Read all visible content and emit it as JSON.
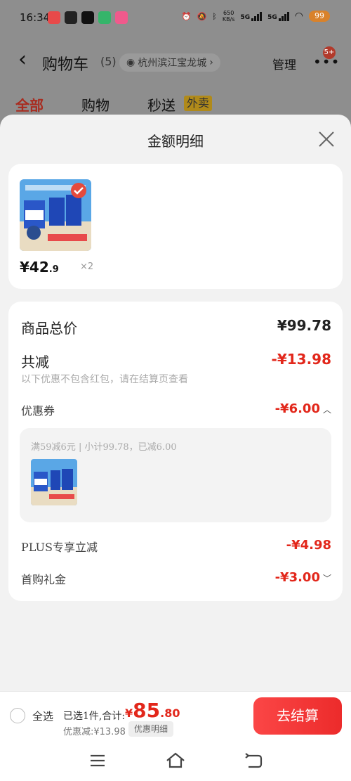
{
  "status_bar": {
    "time": "16:34",
    "net_speed_value": "650",
    "net_speed_unit": "KB/s",
    "net_type_1": "5G",
    "net_type_2": "5G",
    "battery": "99",
    "app_icon_colors": [
      "#e84a4a",
      "#222222",
      "#111111",
      "#35b56a",
      "#f05a8c"
    ]
  },
  "cart": {
    "back_icon": "chevron-left-icon",
    "title": "购物车",
    "count": "(5)",
    "location": "杭州滨江宝龙城",
    "manage": "管理",
    "more_badge": "5+",
    "tabs": [
      {
        "label": "全部",
        "active": true
      },
      {
        "label": "购物",
        "active": false
      },
      {
        "label": "秒送",
        "active": false
      }
    ],
    "waimai_tag": "外卖"
  },
  "sheet": {
    "title": "金额明细",
    "product": {
      "price_main": "¥42",
      "price_decimal": ".9",
      "quantity": "×2"
    },
    "detail": {
      "total_label": "商品总价",
      "total_value": "¥99.78",
      "reduce_label": "共减",
      "reduce_value": "-¥13.98",
      "reduce_note": "以下优惠不包含红包，请在结算页查看",
      "coupon_label": "优惠券",
      "coupon_value": "-¥6.00",
      "coupon_text": "满59减6元 | 小计99.78，已减6.00",
      "plus_label": "PLUS专享立减",
      "plus_value": "-¥4.98",
      "gift_label": "首购礼金",
      "gift_value": "-¥3.00"
    }
  },
  "bottom_bar": {
    "select_all": "全选",
    "selected_info": "已选1件,合计:",
    "total_yen": "¥",
    "total_int": "85",
    "total_dec": ".80",
    "discount": "优惠减:¥13.98",
    "detail_tag": "优惠明细",
    "checkout": "去结算"
  },
  "colors": {
    "accent_red": "#e2271b",
    "checkout_start": "#fb4646",
    "checkout_end": "#ec2b2b"
  }
}
